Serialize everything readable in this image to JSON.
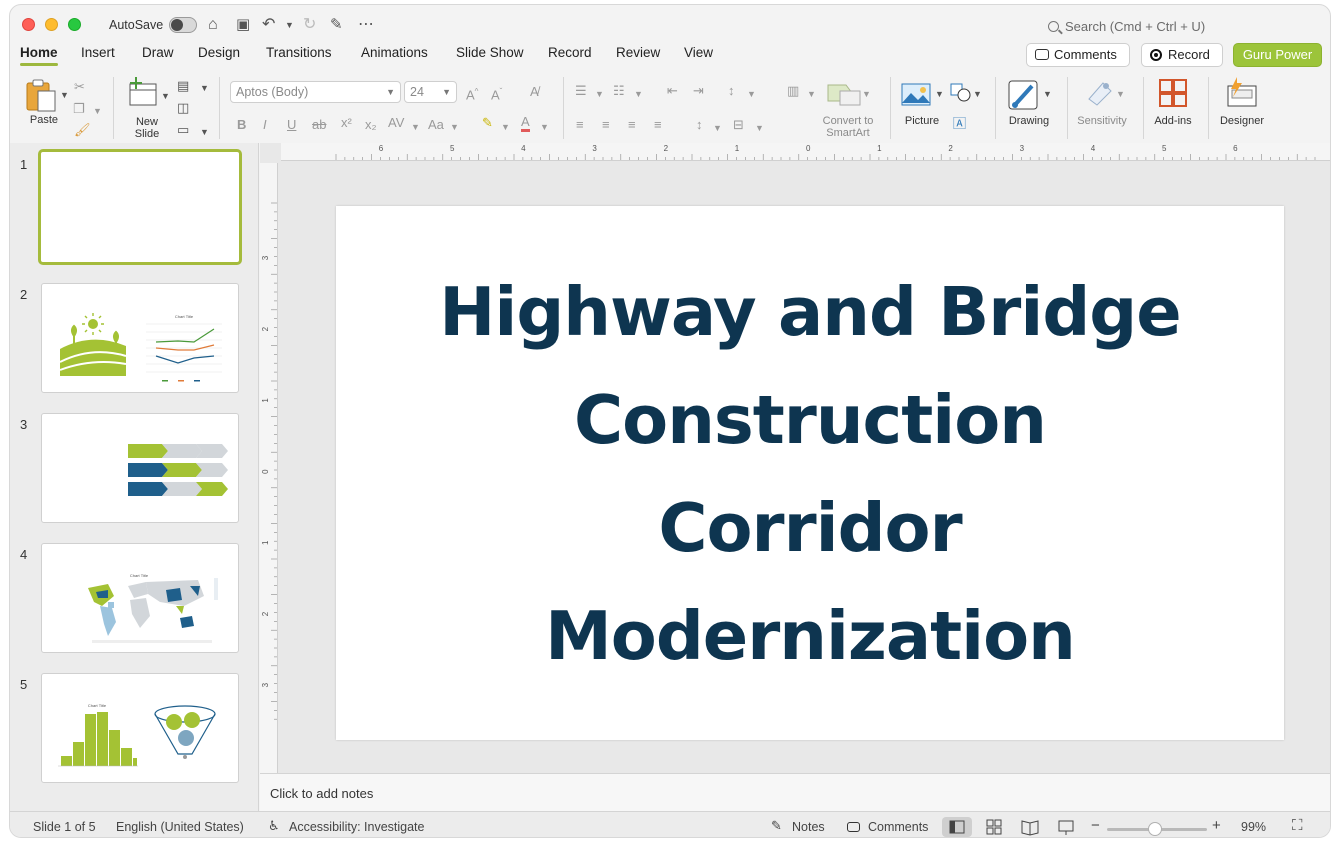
{
  "titlebar": {
    "autosave_label": "AutoSave",
    "search_placeholder": "Search (Cmd + Ctrl + U)"
  },
  "tabs": [
    {
      "label": "Home",
      "active": true
    },
    {
      "label": "Insert"
    },
    {
      "label": "Draw"
    },
    {
      "label": "Design"
    },
    {
      "label": "Transitions"
    },
    {
      "label": "Animations"
    },
    {
      "label": "Slide Show"
    },
    {
      "label": "Record"
    },
    {
      "label": "Review"
    },
    {
      "label": "View"
    }
  ],
  "actions": {
    "comments": "Comments",
    "record": "Record",
    "guru": "Guru Power"
  },
  "ribbon": {
    "paste": "Paste",
    "new_slide_1": "New",
    "new_slide_2": "Slide",
    "font_name": "Aptos (Body)",
    "font_size": "24",
    "convert_1": "Convert to",
    "convert_2": "SmartArt",
    "picture": "Picture",
    "drawing": "Drawing",
    "sensitivity": "Sensitivity",
    "addins": "Add-ins",
    "designer": "Designer"
  },
  "slides": [
    {
      "num": "1"
    },
    {
      "num": "2",
      "chart_title": "Chart Title"
    },
    {
      "num": "3"
    },
    {
      "num": "4",
      "chart_title": "Chart Title"
    },
    {
      "num": "5",
      "chart_title": "Chart Title"
    }
  ],
  "ruler": {
    "h_ticks": [
      "6",
      "5",
      "4",
      "3",
      "2",
      "1",
      "0",
      "1",
      "2",
      "3",
      "4",
      "5",
      "6"
    ],
    "v_ticks": [
      "3",
      "2",
      "1",
      "0",
      "1",
      "2",
      "3"
    ]
  },
  "slide": {
    "title_lines": [
      "Highway and Bridge",
      "Construction",
      "Corridor",
      "Modernization"
    ],
    "title_color": "#0e3550"
  },
  "notes_placeholder": "Click to add notes",
  "status": {
    "slide_of": "Slide 1 of 5",
    "language": "English (United States)",
    "accessibility": "Accessibility: Investigate",
    "notes": "Notes",
    "comments": "Comments",
    "zoom": "99%"
  },
  "colors": {
    "accent_green": "#9cc43a",
    "navy": "#0e3550",
    "blue": "#1f5f8b",
    "light_gray": "#d2d6da"
  }
}
